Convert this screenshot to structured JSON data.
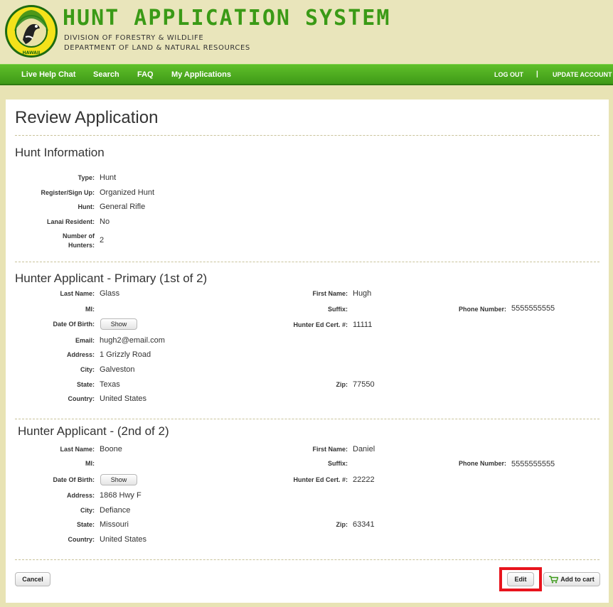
{
  "header": {
    "title": "HUNT APPLICATION SYSTEM",
    "subtitle1": "DIVISION OF FORESTRY & WILDLIFE",
    "subtitle2": "DEPARTMENT OF LAND & NATURAL RESOURCES",
    "logo_top": "FORESTRY AND WILDLIFE",
    "logo_bottom": "HAWAII"
  },
  "nav": {
    "left": [
      "Live Help Chat",
      "Search",
      "FAQ",
      "My Applications"
    ],
    "logout": "LOG OUT",
    "separator": "|",
    "update_account": "UPDATE ACCOUNT"
  },
  "page_title": "Review Application",
  "hunt_info": {
    "title": "Hunt Information",
    "fields": [
      {
        "label": "Type:",
        "value": "Hunt"
      },
      {
        "label": "Register/Sign Up:",
        "value": "Organized Hunt"
      },
      {
        "label": "Hunt:",
        "value": "General Rifle"
      },
      {
        "label": "Lanai Resident:",
        "value": "No"
      },
      {
        "label": "Number of",
        "label2": "Hunters:",
        "value": "2"
      }
    ]
  },
  "hunter1": {
    "title": "Hunter Applicant - Primary (1st of 2)",
    "last_name_label": "Last Name:",
    "last_name": "Glass",
    "first_name_label": "First Name:",
    "first_name": "Hugh",
    "mi_label": "MI:",
    "mi": "",
    "suffix_label": "Suffix:",
    "suffix": "",
    "phone_label": "Phone Number:",
    "phone": "5555555555",
    "dob_label": "Date Of Birth:",
    "dob_button": "Show",
    "cert_label": "Hunter Ed Cert. #:",
    "cert": "11111",
    "email_label": "Email:",
    "email": "hugh2@email.com",
    "address_label": "Address:",
    "address": "1 Grizzly Road",
    "city_label": "City:",
    "city": "Galveston",
    "state_label": "State:",
    "state": "Texas",
    "zip_label": "Zip:",
    "zip": "77550",
    "country_label": "Country:",
    "country": "United States"
  },
  "hunter2": {
    "title": "Hunter Applicant - (2nd of 2)",
    "last_name_label": "Last Name:",
    "last_name": "Boone",
    "first_name_label": "First Name:",
    "first_name": "Daniel",
    "mi_label": "MI:",
    "mi": "",
    "suffix_label": "Suffix:",
    "suffix": "",
    "phone_label": "Phone Number:",
    "phone": "5555555555",
    "dob_label": "Date Of Birth:",
    "dob_button": "Show",
    "cert_label": "Hunter Ed Cert. #:",
    "cert": "22222",
    "address_label": "Address:",
    "address": "1868 Hwy F",
    "city_label": "City:",
    "city": "Defiance",
    "state_label": "State:",
    "state": "Missouri",
    "zip_label": "Zip:",
    "zip": "63341",
    "country_label": "Country:",
    "country": "United States"
  },
  "actions": {
    "cancel": "Cancel",
    "edit": "Edit",
    "add_to_cart": "Add to cart"
  },
  "colors": {
    "brand_green": "#3a9a16",
    "nav_green": "#4eae1f",
    "highlight_red": "#e8141d",
    "background": "#e8e3b4"
  }
}
